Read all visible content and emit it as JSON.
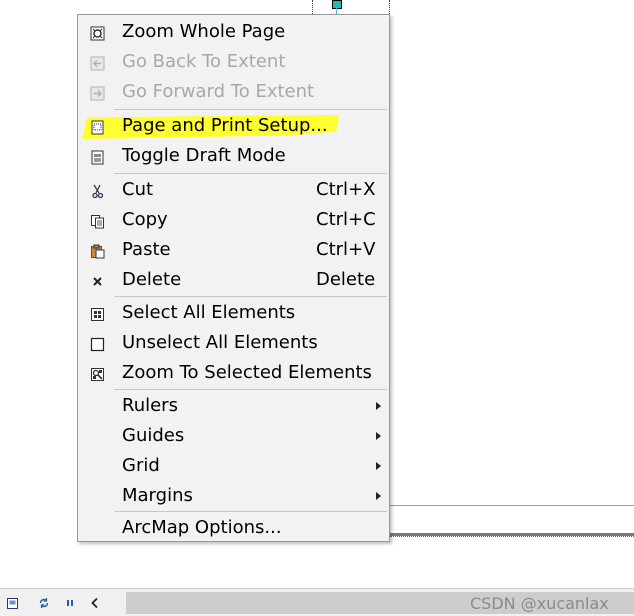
{
  "menu": {
    "items": [
      {
        "label": "Zoom Whole Page",
        "icon": "zoom-whole-page-icon",
        "disabled": false
      },
      {
        "label": "Go Back To Extent",
        "icon": "go-back-extent-icon",
        "disabled": true
      },
      {
        "label": "Go Forward To Extent",
        "icon": "go-forward-extent-icon",
        "disabled": true
      },
      {
        "label": "Page and Print Setup...",
        "icon": "page-setup-icon",
        "disabled": false,
        "highlighted": true
      },
      {
        "label": "Toggle Draft Mode",
        "icon": "draft-mode-icon",
        "disabled": false
      },
      {
        "label": "Cut",
        "shortcut": "Ctrl+X",
        "icon": "scissors-icon",
        "disabled": false
      },
      {
        "label": "Copy",
        "shortcut": "Ctrl+C",
        "icon": "copy-icon",
        "disabled": false
      },
      {
        "label": "Paste",
        "shortcut": "Ctrl+V",
        "icon": "paste-icon",
        "disabled": false
      },
      {
        "label": "Delete",
        "shortcut": "Delete",
        "icon": "delete-x-icon",
        "disabled": false
      },
      {
        "label": "Select All Elements",
        "icon": "select-all-icon",
        "disabled": false
      },
      {
        "label": "Unselect All Elements",
        "icon": "unselect-all-icon",
        "disabled": false
      },
      {
        "label": "Zoom To Selected Elements",
        "icon": "zoom-selected-icon",
        "disabled": false
      },
      {
        "label": "Rulers",
        "submenu": true
      },
      {
        "label": "Guides",
        "submenu": true
      },
      {
        "label": "Grid",
        "submenu": true
      },
      {
        "label": "Margins",
        "submenu": true
      },
      {
        "label": "ArcMap Options...",
        "disabled": false
      }
    ]
  },
  "statusbar": {
    "watermark": "CSDN @xucanlax",
    "buttons": [
      "layout-view-icon",
      "refresh-icon",
      "pause-icon",
      "scroll-left-icon"
    ]
  },
  "colors": {
    "highlight": "#ffff30",
    "accent_line": "#3cc8c8",
    "menu_bg": "#f2f2f2",
    "disabled_text": "#a8a8a8"
  }
}
